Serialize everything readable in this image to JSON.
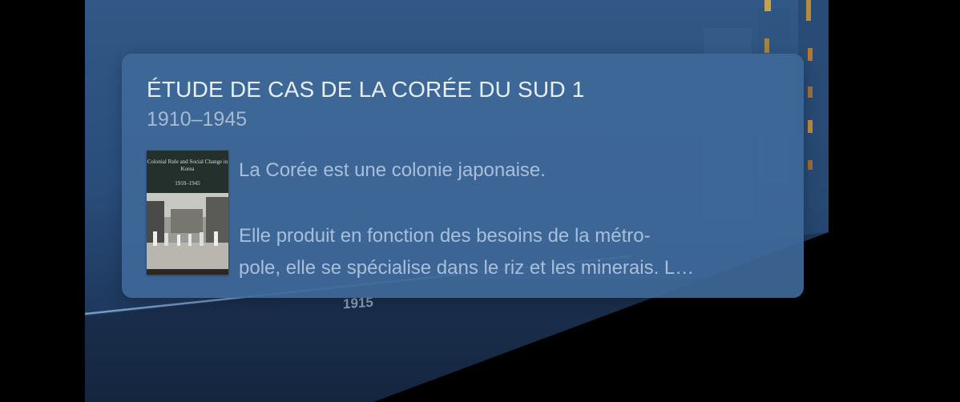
{
  "timeline": {
    "year_label": "1915"
  },
  "card": {
    "title": "ÉTUDE DE CAS DE LA CORÉE DU SUD 1",
    "subtitle": "1910–1945",
    "book_cover": {
      "title": "Colonial Rule and Social Change in Korea",
      "years": "1910–1945",
      "icon": "book-cover-image"
    },
    "description": {
      "line1": "La Corée est une colonie japonaise.",
      "line2": "Elle produit en fonction des besoins de la métro-",
      "line3": "pole, elle se spécialise dans le riz et les minerais. L…"
    }
  },
  "colors": {
    "background_top": "#315886",
    "background_bottom": "#172c4b",
    "card": "#3e6899",
    "title_text": "#e8eef6",
    "muted_text": "#a7bad2"
  }
}
